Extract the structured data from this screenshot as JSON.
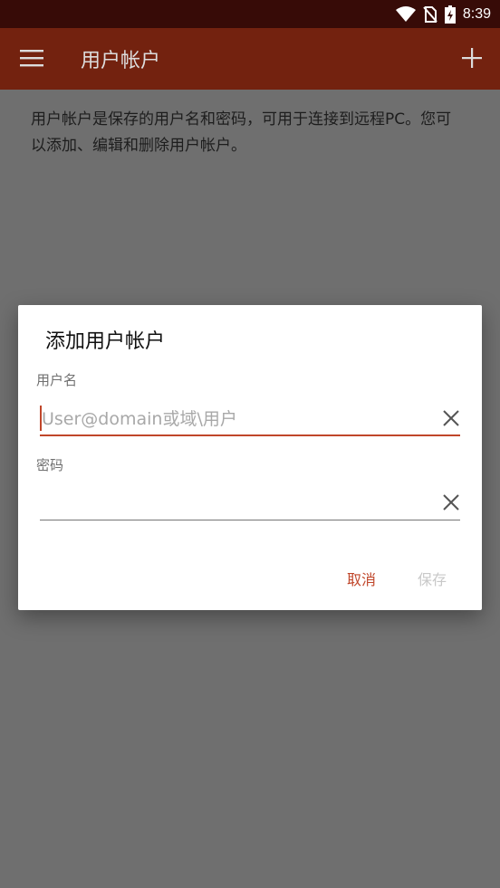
{
  "status_bar": {
    "time": "8:39"
  },
  "app_bar": {
    "title": "用户帐户"
  },
  "content": {
    "description": "用户帐户是保存的用户名和密码，可用于连接到远程PC。您可以添加、编辑和删除用户帐户。"
  },
  "dialog": {
    "title": "添加用户帐户",
    "username": {
      "label": "用户名",
      "placeholder": "User@domain或域\\用户",
      "value": ""
    },
    "password": {
      "label": "密码",
      "value": ""
    },
    "cancel_label": "取消",
    "save_label": "保存"
  },
  "colors": {
    "status_bar": "#370b07",
    "app_bar": "#73220f",
    "accent": "#c0462a",
    "scrim_background": "#6f6f6f"
  }
}
